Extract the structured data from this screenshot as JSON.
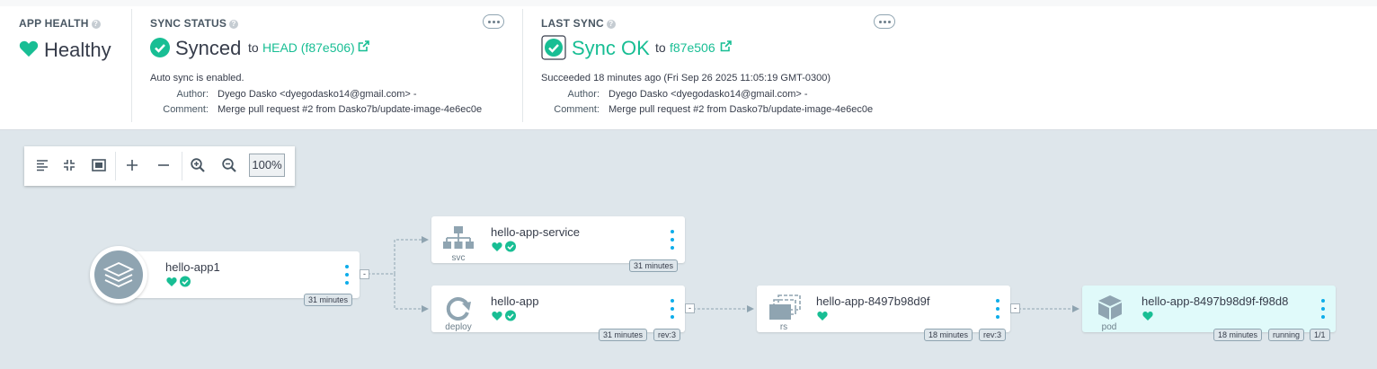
{
  "app_health": {
    "title": "APP HEALTH",
    "status": "Healthy"
  },
  "sync_status": {
    "title": "SYNC STATUS",
    "status": "Synced",
    "to_label": "to",
    "revision": "HEAD (f87e506)",
    "auto_sync": "Auto sync is enabled.",
    "author_label": "Author:",
    "author": "Dyego Dasko <dyegodasko14@gmail.com> -",
    "comment_label": "Comment:",
    "comment": "Merge pull request #2 from Dasko7b/update-image-4e6ec0e"
  },
  "last_sync": {
    "title": "LAST SYNC",
    "status": "Sync OK",
    "to_label": "to",
    "revision": "f87e506",
    "succeeded": "Succeeded 18 minutes ago (Fri Sep 26 2025 11:05:19 GMT-0300)",
    "author_label": "Author:",
    "author": "Dyego Dasko <dyegodasko14@gmail.com> -",
    "comment_label": "Comment:",
    "comment": "Merge pull request #2 from Dasko7b/update-image-4e6ec0e"
  },
  "toolbar": {
    "zoom": "100%"
  },
  "nodes": {
    "app": {
      "name": "hello-app1",
      "age": "31 minutes"
    },
    "service": {
      "name": "hello-app-service",
      "kind": "svc",
      "age": "31 minutes"
    },
    "deploy": {
      "name": "hello-app",
      "kind": "deploy",
      "age": "31 minutes",
      "rev": "rev:3"
    },
    "rs": {
      "name": "hello-app-8497b98d9f",
      "kind": "rs",
      "age": "18 minutes",
      "rev": "rev:3"
    },
    "pod": {
      "name": "hello-app-8497b98d9f-f98d8",
      "kind": "pod",
      "age": "18 minutes",
      "state": "running",
      "ready": "1/1"
    }
  },
  "colors": {
    "healthy": "#18be94",
    "synced": "#18be94",
    "link": "#18be94",
    "menu": "#0dadea",
    "background": "#dee6eb"
  },
  "icons": [
    "heart-icon",
    "check-circle-icon",
    "external-link-icon",
    "more-icon",
    "help-icon",
    "layers-icon",
    "sitemap-icon",
    "redo-icon",
    "copy-icon",
    "cube-icon"
  ]
}
